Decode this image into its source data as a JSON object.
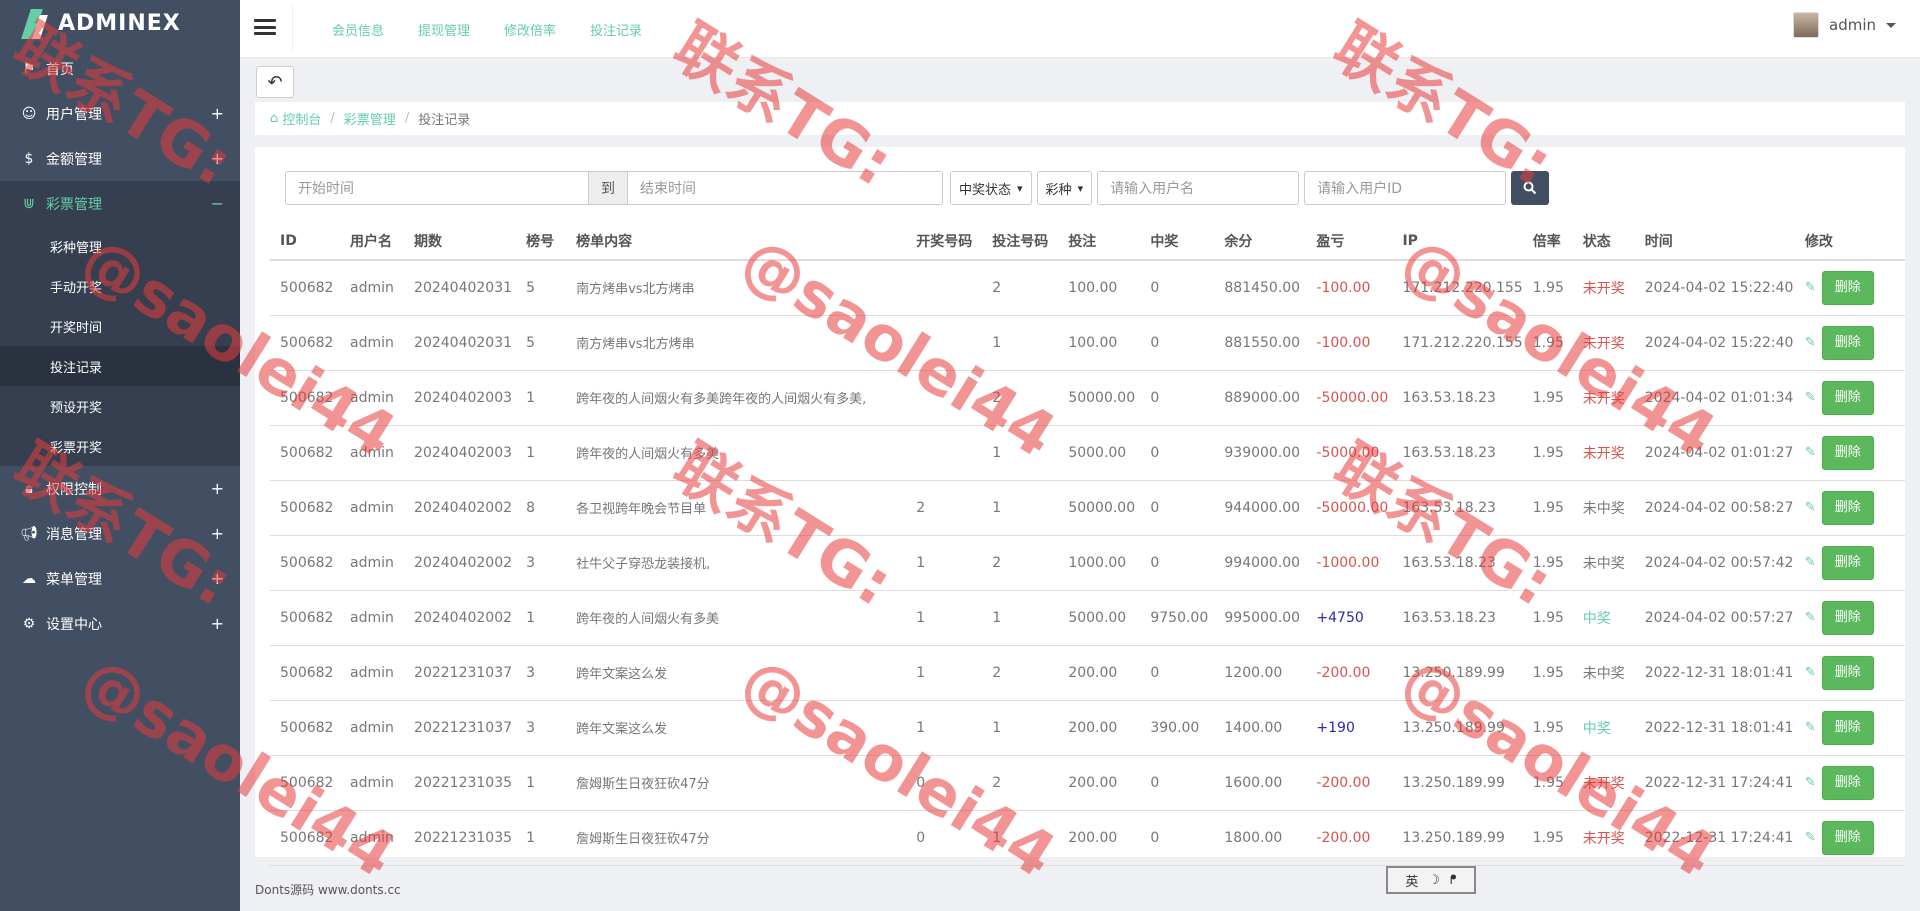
{
  "brand": {
    "name": "ADMINEX"
  },
  "sidebar": {
    "items": [
      {
        "label": "首页",
        "icon": "flag-icon",
        "has_plus": false
      },
      {
        "label": "用户管理",
        "icon": "smile-icon",
        "has_plus": true
      },
      {
        "label": "金额管理",
        "icon": "dollar-icon",
        "has_plus": true
      },
      {
        "label": "彩票管理",
        "icon": "magnet-icon",
        "has_plus": true,
        "expanded": true,
        "children": [
          "彩种管理",
          "手动开奖",
          "开奖时间",
          "投注记录",
          "预设开奖",
          "彩票开奖"
        ]
      },
      {
        "label": "权限控制",
        "icon": "lock-icon",
        "has_plus": true
      },
      {
        "label": "消息管理",
        "icon": "bullhorn-icon",
        "has_plus": true
      },
      {
        "label": "菜单管理",
        "icon": "cloud-icon",
        "has_plus": true
      },
      {
        "label": "设置中心",
        "icon": "gear-icon",
        "has_plus": true
      }
    ],
    "plus": "+",
    "minus": "−"
  },
  "header": {
    "nav": [
      "会员信息",
      "提现管理",
      "修改倍率",
      "投注记录"
    ],
    "user": "admin"
  },
  "breadcrumb": {
    "home": "控制台",
    "parent": "彩票管理",
    "current": "投注记录"
  },
  "filters": {
    "start_placeholder": "开始时间",
    "to": "到",
    "end_placeholder": "结束时间",
    "status_select": "中奖状态",
    "type_select": "彩种",
    "username_placeholder": "请输入用户名",
    "userid_placeholder": "请输入用户ID"
  },
  "table": {
    "columns": [
      "ID",
      "用户名",
      "期数",
      "榜号",
      "榜单内容",
      "开奖号码",
      "投注号码",
      "投注",
      "中奖",
      "余分",
      "盈亏",
      "IP",
      "倍率",
      "状态",
      "时间",
      "修改"
    ],
    "rows": [
      [
        "500682",
        "admin",
        "20240402031",
        "5",
        "南方烤串vs北方烤串",
        "",
        "2",
        "100.00",
        "0",
        "881450.00",
        "-100.00",
        "171.212.220.155",
        "1.95",
        "未开奖",
        "2024-04-02 15:22:40"
      ],
      [
        "500682",
        "admin",
        "20240402031",
        "5",
        "南方烤串vs北方烤串",
        "",
        "1",
        "100.00",
        "0",
        "881550.00",
        "-100.00",
        "171.212.220.155",
        "1.95",
        "未开奖",
        "2024-04-02 15:22:40"
      ],
      [
        "500682",
        "admin",
        "20240402003",
        "1",
        "跨年夜的人间烟火有多美跨年夜的人间烟火有多美,",
        "",
        "2",
        "50000.00",
        "0",
        "889000.00",
        "-50000.00",
        "163.53.18.23",
        "1.95",
        "未开奖",
        "2024-04-02 01:01:34"
      ],
      [
        "500682",
        "admin",
        "20240402003",
        "1",
        "跨年夜的人间烟火有多美",
        "",
        "1",
        "5000.00",
        "0",
        "939000.00",
        "-5000.00",
        "163.53.18.23",
        "1.95",
        "未开奖",
        "2024-04-02 01:01:27"
      ],
      [
        "500682",
        "admin",
        "20240402002",
        "8",
        "各卫视跨年晚会节目单",
        "2",
        "1",
        "50000.00",
        "0",
        "944000.00",
        "-50000.00",
        "163.53.18.23",
        "1.95",
        "未中奖",
        "2024-04-02 00:58:27"
      ],
      [
        "500682",
        "admin",
        "20240402002",
        "3",
        "社牛父子穿恐龙装接机,",
        "1",
        "2",
        "1000.00",
        "0",
        "994000.00",
        "-1000.00",
        "163.53.18.23",
        "1.95",
        "未中奖",
        "2024-04-02 00:57:42"
      ],
      [
        "500682",
        "admin",
        "20240402002",
        "1",
        "跨年夜的人间烟火有多美",
        "1",
        "1",
        "5000.00",
        "9750.00",
        "995000.00",
        "+4750",
        "163.53.18.23",
        "1.95",
        "中奖",
        "2024-04-02 00:57:27"
      ],
      [
        "500682",
        "admin",
        "20221231037",
        "3",
        "跨年文案这么发",
        "1",
        "2",
        "200.00",
        "0",
        "1200.00",
        "-200.00",
        "13.250.189.99",
        "1.95",
        "未中奖",
        "2022-12-31 18:01:41"
      ],
      [
        "500682",
        "admin",
        "20221231037",
        "3",
        "跨年文案这么发",
        "1",
        "1",
        "200.00",
        "390.00",
        "1400.00",
        "+190",
        "13.250.189.99",
        "1.95",
        "中奖",
        "2022-12-31 18:01:41"
      ],
      [
        "500682",
        "admin",
        "20221231035",
        "1",
        "詹姆斯生日夜狂砍47分",
        "0",
        "2",
        "200.00",
        "0",
        "1600.00",
        "-200.00",
        "13.250.189.99",
        "1.95",
        "未开奖",
        "2022-12-31 17:24:41"
      ],
      [
        "500682",
        "admin",
        "20221231035",
        "1",
        "詹姆斯生日夜狂砍47分",
        "0",
        "1",
        "200.00",
        "0",
        "1800.00",
        "-200.00",
        "13.250.189.99",
        "1.95",
        "未开奖",
        "2022-12-31 17:24:41"
      ]
    ],
    "delete_label": "删除"
  },
  "footer": {
    "text": "Donts源码 www.donts.cc"
  },
  "ime": {
    "lang": "英",
    "moon": "☽",
    "punct": "ᖰ"
  },
  "watermark": {
    "line1": "联系TG:",
    "line2": "@saolei44"
  },
  "colors": {
    "sidebar": "#424f63",
    "accent": "#65cea7",
    "danger": "#d9534f",
    "success": "#5cb85c",
    "watermark": "#e83c3c"
  }
}
